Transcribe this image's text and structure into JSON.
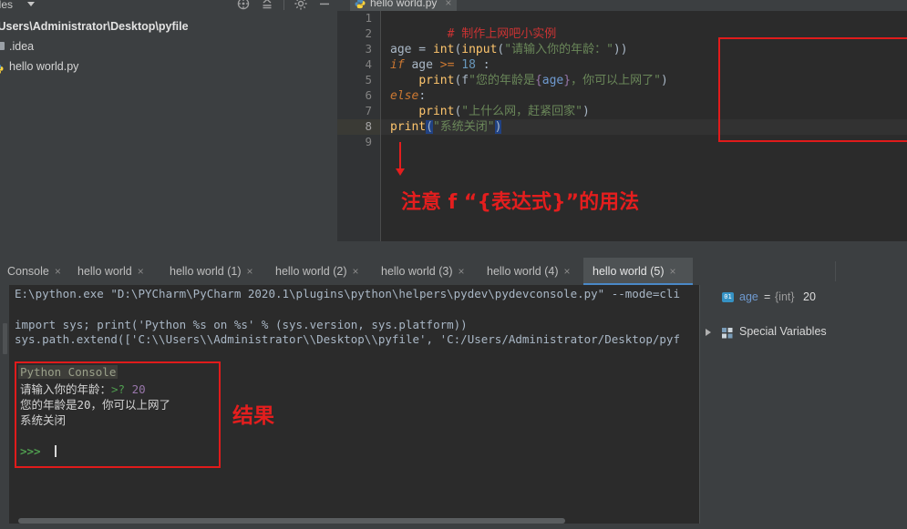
{
  "project": {
    "title": "ct Files",
    "caret_icon": "chevron-down-icon",
    "toolbar_icons": [
      "locate-icon",
      "collapse-all-icon",
      "settings-icon",
      "hide-icon"
    ],
    "tree": [
      {
        "label": "\\Users\\Administrator\\Desktop\\pyfile",
        "icon": "project-root-icon"
      },
      {
        "label": ".idea",
        "icon": "folder-icon"
      },
      {
        "label": "hello world.py",
        "icon": "python-file-icon"
      }
    ]
  },
  "editor": {
    "tab": {
      "label": "hello world.py",
      "icon": "python-file-icon",
      "close": "×"
    },
    "line_numbers": [
      "1",
      "2",
      "3",
      "4",
      "5",
      "6",
      "7",
      "8",
      "9"
    ],
    "current_line": 8,
    "lines": [
      {
        "n": 1,
        "text": "# 制作上网吧小实例"
      },
      {
        "n": 2,
        "text": ""
      },
      {
        "n": 3,
        "text": "age = int(input(\"请输入你的年龄：\"))"
      },
      {
        "n": 4,
        "text": "if age >= 18 :"
      },
      {
        "n": 5,
        "text": "    print(f\"您的年龄是{age}，你可以上网了\")"
      },
      {
        "n": 6,
        "text": "else:"
      },
      {
        "n": 7,
        "text": "    print(\"上什么网，赶紧回家\")"
      },
      {
        "n": 8,
        "text": "print(\"系统关闭\")"
      },
      {
        "n": 9,
        "text": ""
      }
    ],
    "tokens": {
      "comment": "# 制作上网吧小实例",
      "l3_var": "age",
      "l3_op": " = ",
      "l3_int": "int",
      "l3_p1": "(",
      "l3_input": "input",
      "l3_p2": "(",
      "l3_str": "\"请输入你的年龄：\"",
      "l3_p3": "))",
      "l4_if": "if",
      "l4_var": " age ",
      "l4_ge": ">=",
      "l4_num": " 18",
      "l4_colon": " :",
      "l5_indent": "    ",
      "l5_print": "print",
      "l5_p1": "(",
      "l5_f": "f",
      "l5_q1": "\"",
      "l5_s1": "您的年龄是",
      "l5_br1": "{",
      "l5_expr": "age",
      "l5_br2": "}",
      "l5_s2": "，你可以上网了",
      "l5_q2": "\"",
      "l5_p2": ")",
      "l6_else": "else",
      "l6_colon": ":",
      "l7_indent": "    ",
      "l7_print": "print",
      "l7_p1": "(",
      "l7_str": "\"上什么网，赶紧回家\"",
      "l7_p2": ")",
      "l8_print": "print",
      "l8_p1": "(",
      "l8_str": "\"系统关闭\"",
      "l8_p2": ")"
    },
    "annotation": {
      "text": "注意 f “{表达式}”的用法",
      "color": "#e41e1e",
      "box_color": "#e01b1b",
      "arrow_icon": "down-arrow-icon"
    }
  },
  "console_tabs": [
    {
      "label": "Console",
      "close": "×",
      "active": false
    },
    {
      "label": "hello world",
      "close": "×",
      "active": false
    },
    {
      "label": "hello world (1)",
      "close": "×",
      "active": false
    },
    {
      "label": "hello world (2)",
      "close": "×",
      "active": false
    },
    {
      "label": "hello world (3)",
      "close": "×",
      "active": false
    },
    {
      "label": "hello world (4)",
      "close": "×",
      "active": false
    },
    {
      "label": "hello world (5)",
      "close": "×",
      "active": true
    }
  ],
  "console": {
    "line1": "E:\\python.exe \"D:\\PYCharm\\PyCharm 2020.1\\plugins\\python\\helpers\\pydev\\pydevconsole.py\" --mode=cli",
    "line2": "import sys; print('Python %s on %s' % (sys.version, sys.platform))",
    "line3": "sys.path.extend(['C:\\\\Users\\\\Administrator\\\\Desktop\\\\pyfile', 'C:/Users/Administrator/Desktop/pyf",
    "box": {
      "title": "Python Console",
      "prompt_line_text": "请输入你的年龄：",
      "prompt_marker": ">?",
      "input_value": "20",
      "output_line1": "您的年龄是20，你可以上网了",
      "output_line2": "系统关闭",
      "prompt": ">>>",
      "border_color": "#e01b1b"
    },
    "annotation": {
      "text": "结果",
      "color": "#e41e1e"
    }
  },
  "variables": {
    "rows": [
      {
        "icon": "int-badge-icon",
        "badge": "01",
        "name": "age",
        "eq": "=",
        "type": "{int}",
        "value": "20",
        "expandable": false
      },
      {
        "icon": "special-variables-icon",
        "name": "Special Variables",
        "expandable": true
      }
    ]
  }
}
